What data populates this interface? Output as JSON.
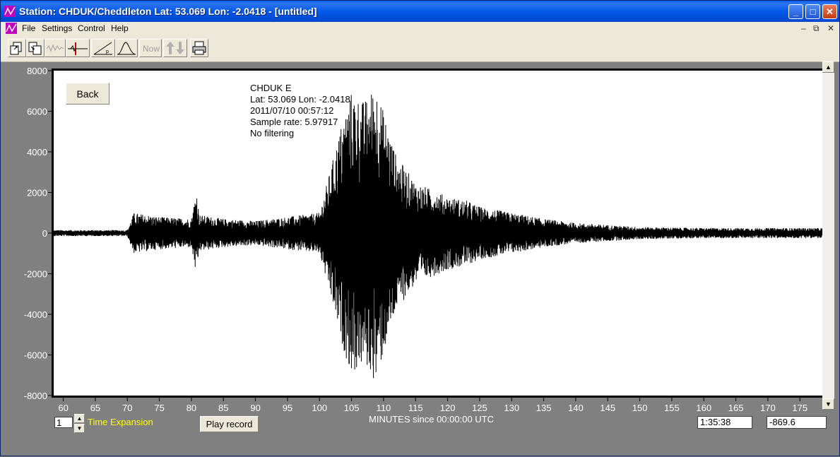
{
  "window": {
    "title": "Station: CHDUK/Cheddleton Lat: 53.069 Lon: -2.0418 - [untitled]",
    "minimize": "_",
    "maximize": "□",
    "close": "✕"
  },
  "menu": {
    "items": [
      "File",
      "Settings",
      "Control",
      "Help"
    ],
    "mdi_minimize": "–",
    "mdi_restore": "⧉",
    "mdi_close": "✕"
  },
  "toolbar": {
    "buttons": [
      "open-file-icon",
      "save-file-icon",
      "wave-icon",
      "pick-icon",
      "slope-icon",
      "spectrum-icon",
      "Now",
      "scroll-arrows-icon",
      "print-icon"
    ],
    "now_label": "Now"
  },
  "plot": {
    "back_label": "Back",
    "info": {
      "station": "CHDUK  E",
      "location": "Lat: 53.069 Lon: -2.0418",
      "datetime": "2011/07/10 00:57:12",
      "sample_rate": "Sample rate: 5.97917",
      "filter": "No filtering"
    }
  },
  "controls": {
    "expansion_value": "1",
    "expansion_label": "Time Expansion",
    "play_label": "Play record",
    "xaxis_label": "MINUTES since 00:00:00 UTC",
    "time_readout": "1:35:38",
    "value_readout": "-869.6"
  },
  "chart_data": {
    "type": "line",
    "title": "",
    "xlabel": "MINUTES since 00:00:00 UTC",
    "ylabel": "",
    "xlim": [
      58.5,
      178.5
    ],
    "ylim": [
      -8000,
      8000
    ],
    "xticks": [
      60,
      65,
      70,
      75,
      80,
      85,
      90,
      95,
      100,
      105,
      110,
      115,
      120,
      125,
      130,
      135,
      140,
      145,
      150,
      155,
      160,
      165,
      170,
      175
    ],
    "yticks": [
      8000,
      6000,
      4000,
      2000,
      0,
      -2000,
      -4000,
      -6000,
      -8000
    ],
    "grid": false,
    "series": [
      {
        "x": [
          58.5,
          70,
          71,
          75,
          80,
          80.8,
          81.2,
          85,
          90,
          95,
          100,
          102,
          103.5,
          105,
          107,
          108.8,
          110,
          112,
          115,
          120,
          123,
          125,
          130,
          135,
          140,
          150,
          160,
          170,
          178.5
        ],
        "y_envelope": [
          150,
          150,
          1000,
          800,
          700,
          2200,
          900,
          700,
          600,
          800,
          1000,
          3500,
          5500,
          7000,
          6500,
          7400,
          6000,
          3800,
          2500,
          1800,
          1600,
          1300,
          1000,
          700,
          500,
          300,
          250,
          250,
          250
        ]
      }
    ]
  }
}
